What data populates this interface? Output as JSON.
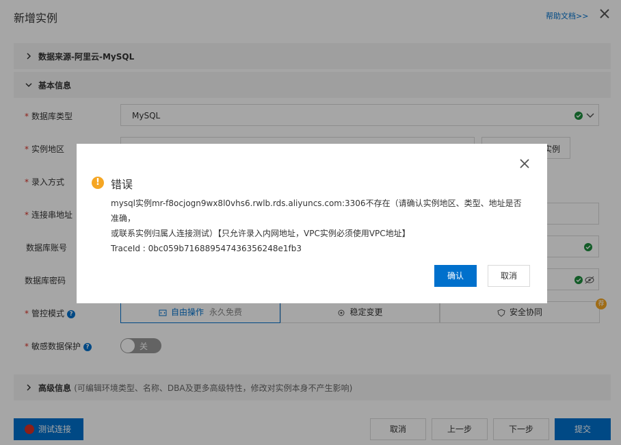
{
  "header": {
    "title": "新增实例",
    "help_link": "帮助文档>>"
  },
  "sections": {
    "datasource": "数据来源-阿里云-MySQL",
    "basic": "基本信息",
    "advanced": "高级信息",
    "advanced_note": "(可编辑环境类型、名称、DBA及更多高级特性，修改对实例本身不产生影响)"
  },
  "form": {
    "db_type_label": "数据库类型",
    "db_type_value": "MySQL",
    "region_label": "实例地区",
    "region_button_tail": "实例",
    "entry_label": "录入方式",
    "conn_label": "连接串地址",
    "account_label": "数据库账号",
    "password_label": "数据库密码",
    "control_label": "管控模式",
    "control_options": [
      "自由操作",
      "稳定变更",
      "安全协同"
    ],
    "control_free_tag": "永久免费",
    "sensitive_label": "敏感数据保护",
    "sensitive_switch": "关",
    "recommend_badge": "荐"
  },
  "footer": {
    "test": "测试连接",
    "cancel": "取消",
    "prev": "上一步",
    "next": "下一步",
    "submit": "提交"
  },
  "dialog": {
    "title": "错误",
    "line1": "mysql实例mr-f8ocjogn9wx8l0vhs6.rwlb.rds.aliyuncs.com:3306不存在（请确认实例地区、类型、地址是否准确，",
    "line2": "或联系实例归属人连接测试）【只允许录入内网地址，VPC实例必须使用VPC地址】",
    "trace": "TraceId : 0bc059b716889547436356248e1fb3",
    "confirm": "确认",
    "cancel": "取消"
  },
  "colors": {
    "primary": "#0070cc",
    "success": "#1e8e3e",
    "warning": "#f5a623",
    "required": "#d93026"
  }
}
